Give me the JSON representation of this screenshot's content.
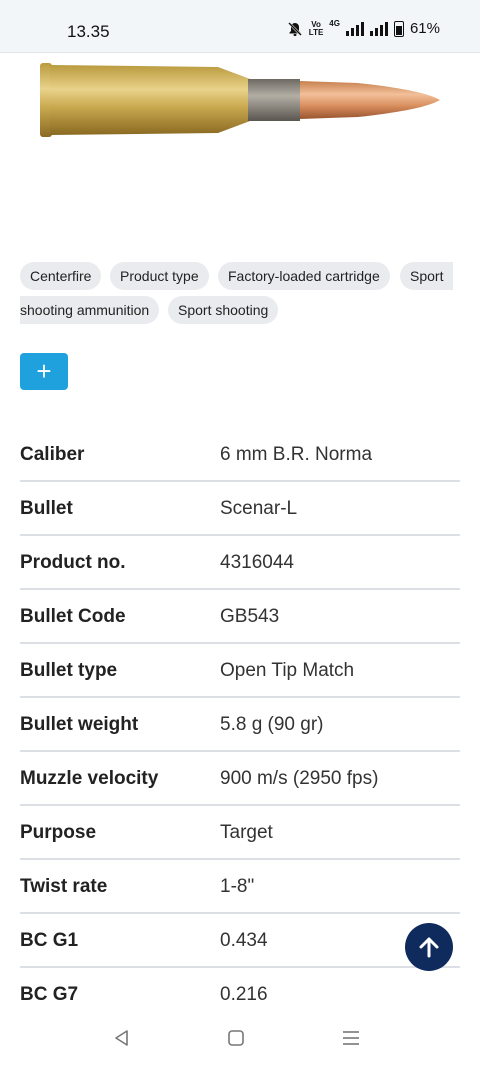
{
  "status_bar": {
    "time": "13.35",
    "volte_top": "Vo",
    "volte_bottom": "LTE",
    "network": "4G",
    "battery": "61%"
  },
  "product": {
    "image_icon": "cartridge-image"
  },
  "tags": [
    "Centerfire",
    "Product type",
    "Factory-loaded cartridge",
    "Sport",
    "shooting ammunition",
    "Sport shooting"
  ],
  "expand_button": "+",
  "specs": [
    {
      "label": "Caliber",
      "value": "6 mm B.R. Norma"
    },
    {
      "label": "Bullet",
      "value": "Scenar-L"
    },
    {
      "label": "Product no.",
      "value": "4316044"
    },
    {
      "label": "Bullet Code",
      "value": "GB543"
    },
    {
      "label": "Bullet type",
      "value": "Open Tip Match"
    },
    {
      "label": "Bullet weight",
      "value": "5.8 g (90 gr)"
    },
    {
      "label": "Muzzle velocity",
      "value": "900 m/s (2950 fps)"
    },
    {
      "label": "Purpose",
      "value": "Target"
    },
    {
      "label": "Twist rate",
      "value": "1-8\""
    },
    {
      "label": "BC G1",
      "value": "0.434"
    },
    {
      "label": "BC G7",
      "value": "0.216"
    }
  ],
  "colors": {
    "accent": "#1ea1dc",
    "scroll_top": "#0f2b5e"
  }
}
